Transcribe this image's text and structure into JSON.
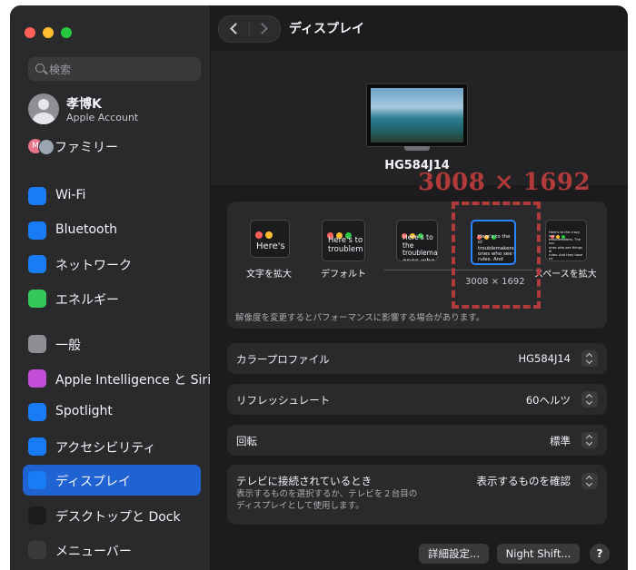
{
  "sidebar": {
    "search_placeholder": "検索",
    "account": {
      "name": "孝博K",
      "subtitle": "Apple Account"
    },
    "family": {
      "label": "ファミリー",
      "avatar_letter": "M"
    },
    "items": [
      {
        "label": "Wi-Fi",
        "icon": "wifi-icon",
        "color": "#1a7cf5"
      },
      {
        "label": "Bluetooth",
        "icon": "bluetooth-icon",
        "color": "#1a7cf5"
      },
      {
        "label": "ネットワーク",
        "icon": "globe-icon",
        "color": "#1a7cf5"
      },
      {
        "label": "エネルギー",
        "icon": "battery-bolt-icon",
        "color": "#34c759"
      },
      {
        "label": "一般",
        "icon": "gear-icon",
        "color": "#8e8e93"
      },
      {
        "label": "Apple Intelligence と Siri",
        "icon": "siri-icon",
        "color": "#c24dd6"
      },
      {
        "label": "Spotlight",
        "icon": "magnifier-icon",
        "color": "#1a7cf5"
      },
      {
        "label": "アクセシビリティ",
        "icon": "accessibility-icon",
        "color": "#1a7cf5"
      },
      {
        "label": "ディスプレイ",
        "icon": "sun-icon",
        "color": "#1a7cf5",
        "active": true
      },
      {
        "label": "デスクトップと Dock",
        "icon": "dock-icon",
        "color": "#1c1c1e"
      },
      {
        "label": "メニューバー",
        "icon": "toggles-icon",
        "color": "#3a3a3c"
      }
    ]
  },
  "header": {
    "title": "ディスプレイ"
  },
  "display": {
    "monitor_name": "HG584J14",
    "resolution_overlay": "3008 × 1692",
    "resolution_options": [
      {
        "label": "文字を拡大",
        "preview": "Here's"
      },
      {
        "label": "デフォルト",
        "preview": "Here's to\ntroublem"
      },
      {
        "label": "",
        "preview": "Here's to the\ntroublema\nones who"
      },
      {
        "label": "",
        "preview": "Here's to the cr\ntroublemakers.\nones who see t\nrules. And they"
      },
      {
        "label": "スペースを拡大",
        "preview": "Here's to the crazy one\ntroublemakers. The rou\nones who see things di\nrules. And they have no\ncan quote them, disagr\nthem. About the only th\nBecause they change th"
      }
    ],
    "selected_resolution": "3008 × 1692",
    "note": "解像度を変更するとパフォーマンスに影響する場合があります。"
  },
  "settings": {
    "color_profile": {
      "label": "カラープロファイル",
      "value": "HG584J14"
    },
    "refresh_rate": {
      "label": "リフレッシュレート",
      "value": "60ヘルツ"
    },
    "rotation": {
      "label": "回転",
      "value": "標準"
    },
    "tv": {
      "label": "テレビに接続されているとき",
      "value": "表示するものを確認",
      "description": "表示するものを選択するか、テレビを２台目の\nディスプレイとして使用します。"
    }
  },
  "footer": {
    "advanced_button": "詳細設定...",
    "night_shift_button": "Night Shift...",
    "help": "?"
  }
}
